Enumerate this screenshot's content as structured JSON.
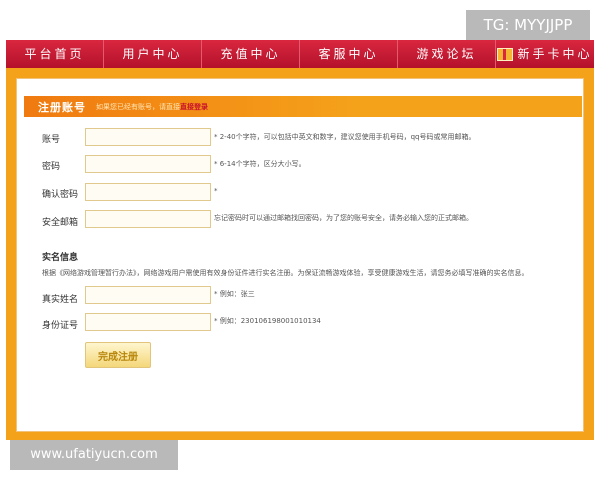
{
  "watermarks": {
    "top": "TG: MYYJJPP",
    "bottom": "www.ufatiyucn.com"
  },
  "nav": {
    "items": [
      "平台首页",
      "用户中心",
      "充值中心",
      "客服中心",
      "游戏论坛",
      "新手卡中心"
    ]
  },
  "form_header": {
    "title": "注册账号",
    "note": "如果您已经有账号，请直接",
    "login_link": "直接登录"
  },
  "fields": {
    "account": {
      "label": "账号",
      "hint": "* 2-40个字符，可以包括中英文和数字，建议您使用手机号码，qq号码或常用邮箱。"
    },
    "password": {
      "label": "密码",
      "hint": "* 6-14个字符，区分大小写。"
    },
    "confirm_password": {
      "label": "确认密码",
      "hint": "*"
    },
    "email": {
      "label": "安全邮箱",
      "hint": "忘记密码时可以通过邮箱找回密码，为了您的账号安全，请务必输入您的正式邮箱。"
    }
  },
  "realname": {
    "title": "实名信息",
    "desc": "根据《网络游戏管理暂行办法》，网络游戏用户需使用有效身份证件进行实名注册。为保证流畅游戏体验，享受健康游戏生活，请您务必填写准确的实名信息。",
    "name": {
      "label": "真实姓名",
      "hint": "* 例如：张三"
    },
    "id_card": {
      "label": "身份证号",
      "hint": "* 例如：230106198001010134"
    }
  },
  "submit_label": "完成注册",
  "colors": {
    "nav_red": "#c8102e",
    "frame_orange": "#f5a21b"
  }
}
